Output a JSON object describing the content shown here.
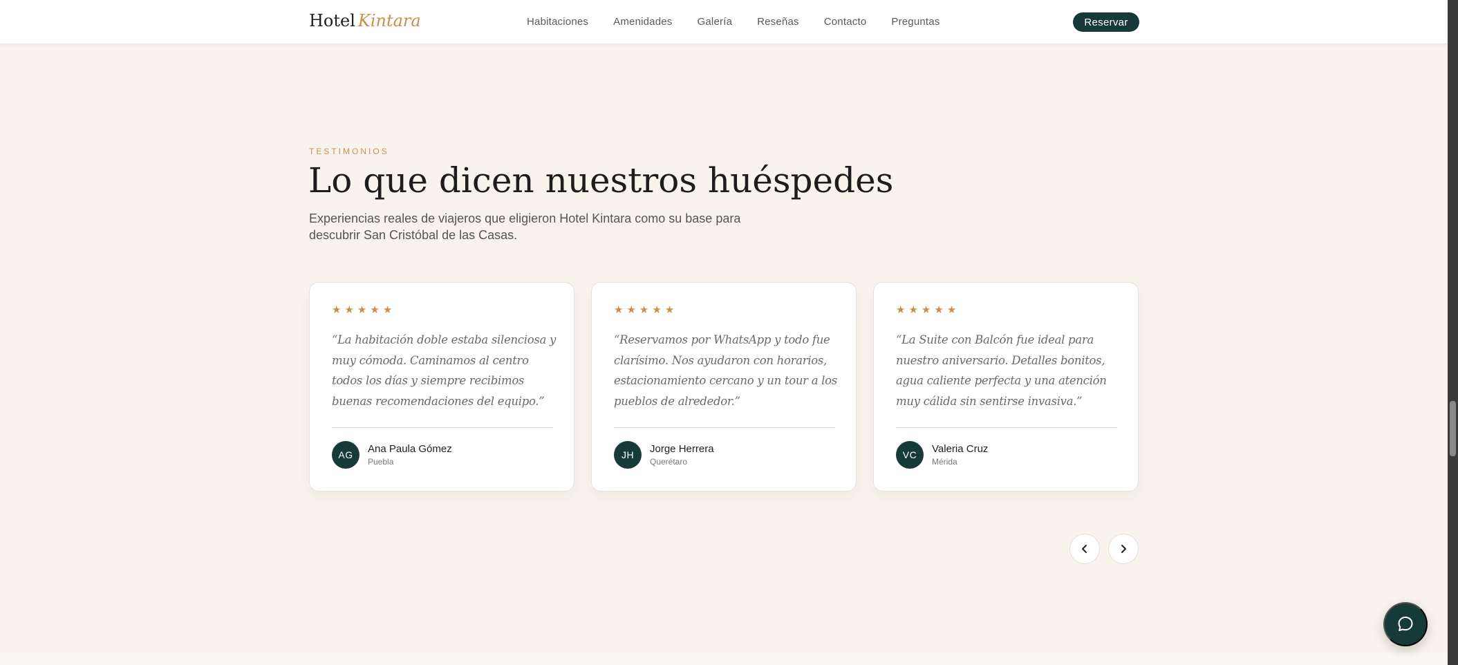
{
  "header": {
    "logo_main": "Hotel",
    "logo_accent": "Kintara",
    "nav": [
      "Habitaciones",
      "Amenidades",
      "Galería",
      "Reseñas",
      "Contacto",
      "Preguntas"
    ],
    "reserve_label": "Reservar"
  },
  "section": {
    "eyebrow": "TESTIMONIOS",
    "title": "Lo que dicen nuestros huéspedes",
    "subtitle": "Experiencias reales de viajeros que eligieron Hotel Kintara como su base para descubrir San Cristóbal de las Casas."
  },
  "testimonials": [
    {
      "rating": 5,
      "quote": "“La habitación doble estaba silenciosa y muy cómoda. Caminamos al centro todos los días y siempre recibimos buenas recomendaciones del equipo.”",
      "initials": "AG",
      "name": "Ana Paula Gómez",
      "city": "Puebla"
    },
    {
      "rating": 5,
      "quote": "“Reservamos por WhatsApp y todo fue clarísimo. Nos ayudaron con horarios, estacionamiento cercano y un tour a los pueblos de alrededor.”",
      "initials": "JH",
      "name": "Jorge Herrera",
      "city": "Querétaro"
    },
    {
      "rating": 5,
      "quote": "“La Suite con Balcón fue ideal para nuestro aniversario. Detalles bonitos, agua caliente perfecta y una atención muy cálida sin sentirse invasiva.”",
      "initials": "VC",
      "name": "Valeria Cruz",
      "city": "Mérida"
    }
  ],
  "icons": {
    "star": "star-icon",
    "prev": "chevron-left-icon",
    "next": "chevron-right-icon",
    "chat": "chat-bubble-icon"
  },
  "colors": {
    "accent": "#c9904b",
    "brand_dark": "#153a38",
    "background": "#f8f3ec"
  }
}
